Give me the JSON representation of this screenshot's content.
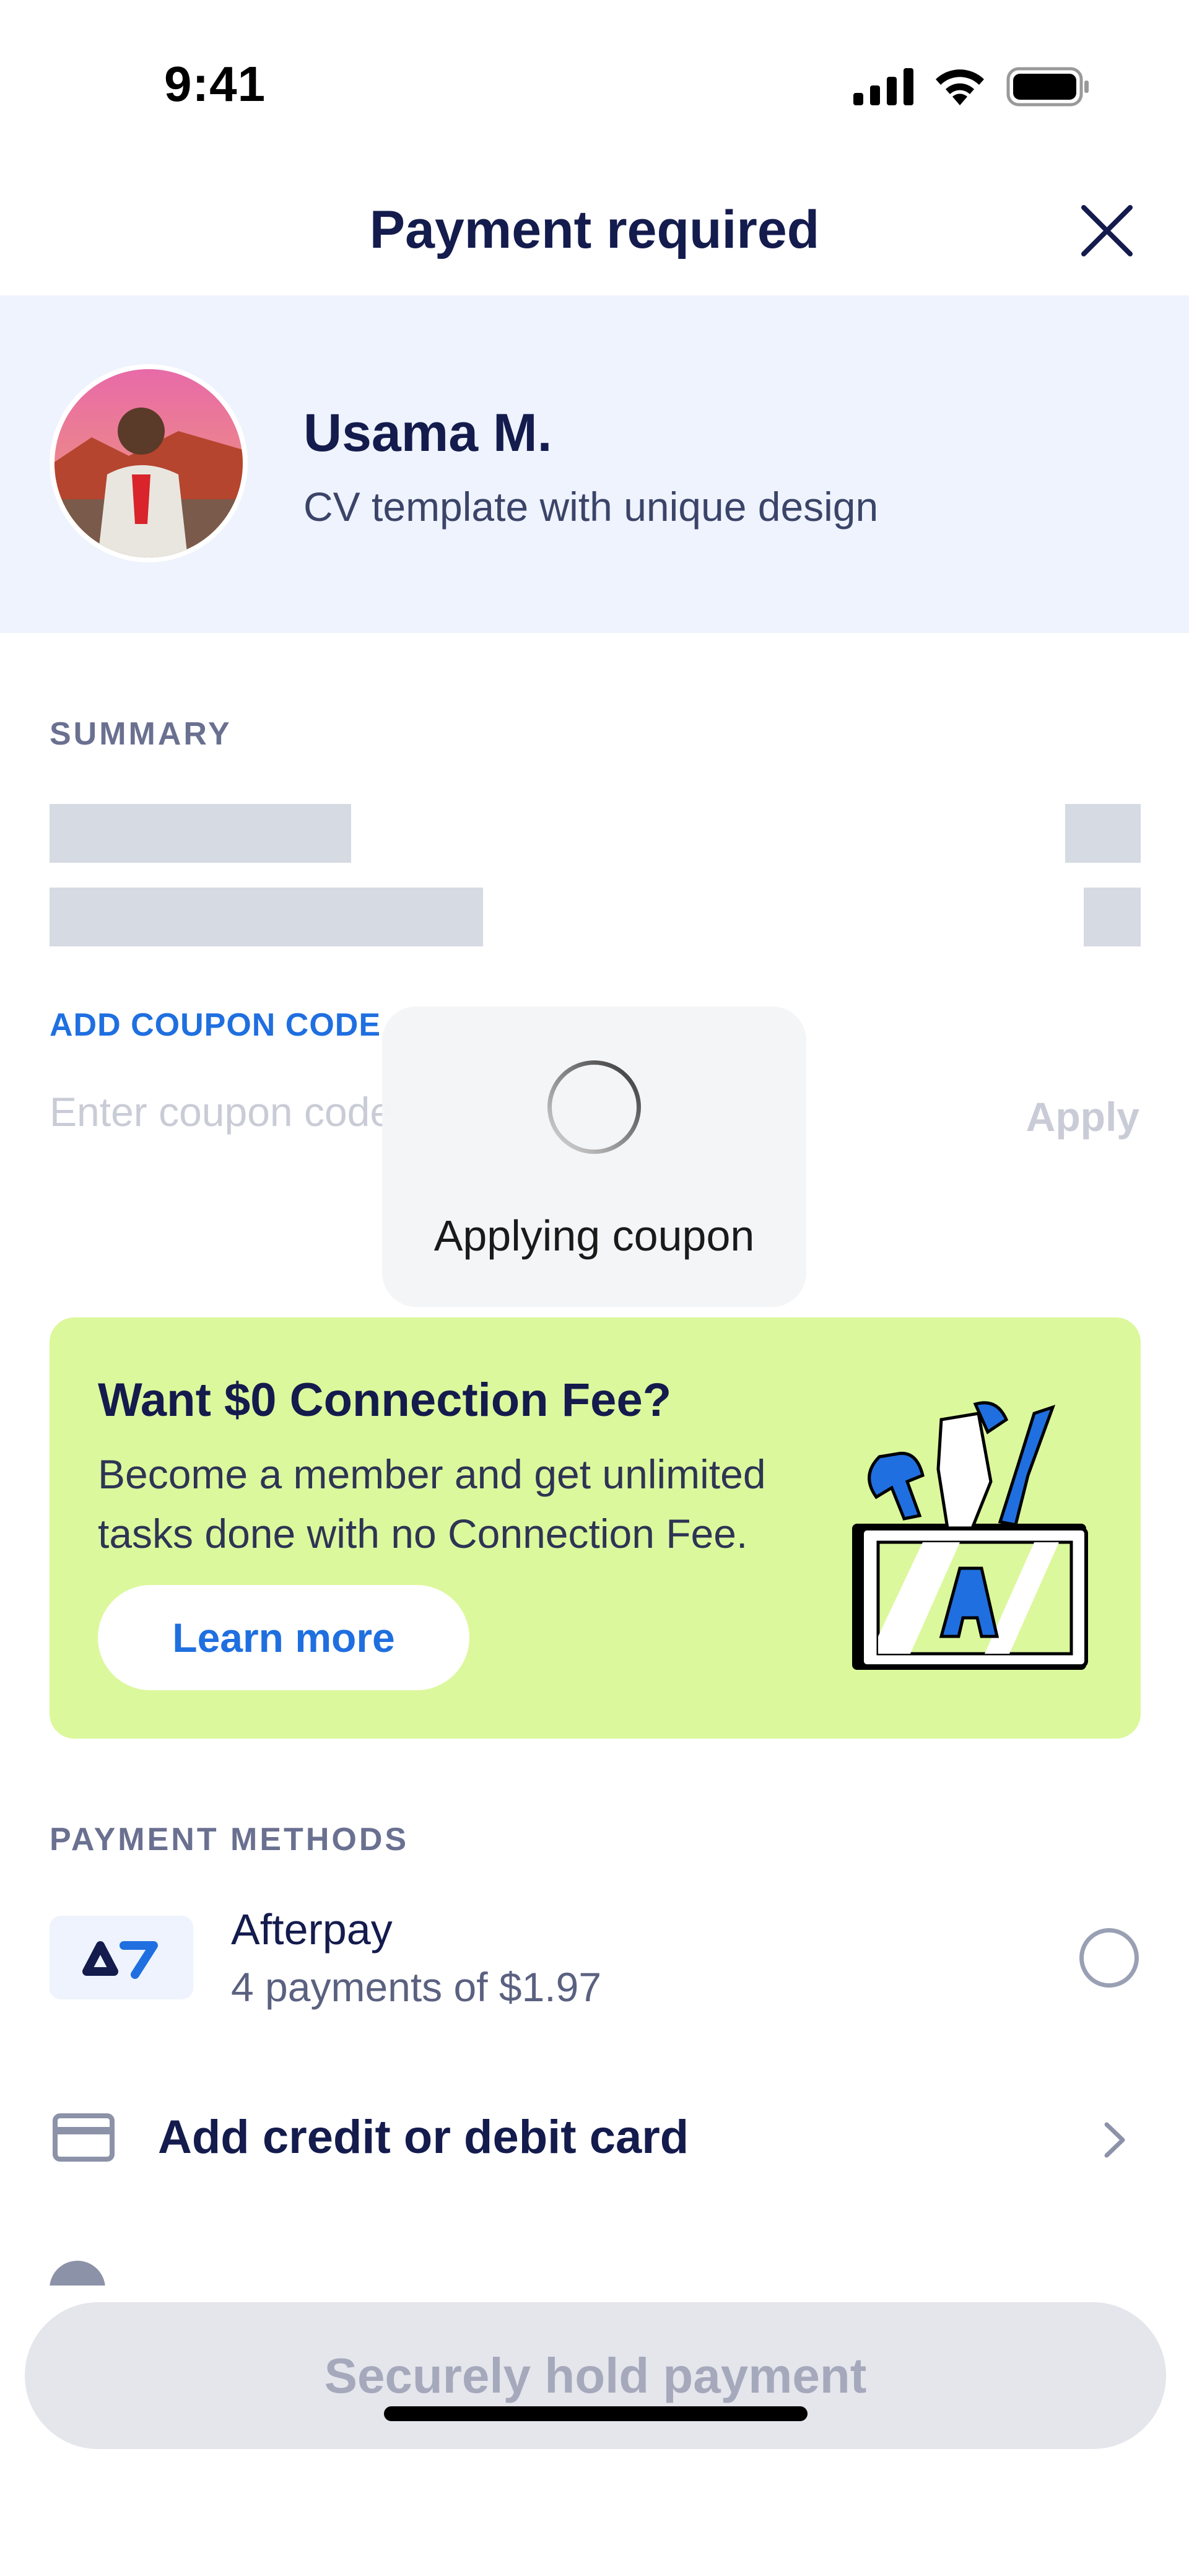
{
  "status_bar": {
    "time": "9:41"
  },
  "header": {
    "title": "Payment required"
  },
  "profile": {
    "name": "Usama M.",
    "task": "CV template with unique design"
  },
  "summary": {
    "label": "SUMMARY"
  },
  "coupon": {
    "label": "ADD COUPON CODE",
    "placeholder": "Enter coupon code",
    "apply": "Apply"
  },
  "loading": {
    "text": "Applying coupon"
  },
  "promo": {
    "title": "Want $0 Connection Fee?",
    "body": "Become a member and get unlimited tasks done with no Connection Fee.",
    "button": "Learn more"
  },
  "payment_methods": {
    "label": "PAYMENT METHODS",
    "afterpay": {
      "name": "Afterpay",
      "detail": "4 payments of $1.97"
    },
    "card": {
      "label": "Add credit or debit card"
    }
  },
  "cta": {
    "label": "Securely hold payment"
  },
  "colors": {
    "accent": "#1f6fe0",
    "navy": "#141b4d",
    "promo_bg": "#dcf89c",
    "banner_bg": "#eef3fd"
  }
}
